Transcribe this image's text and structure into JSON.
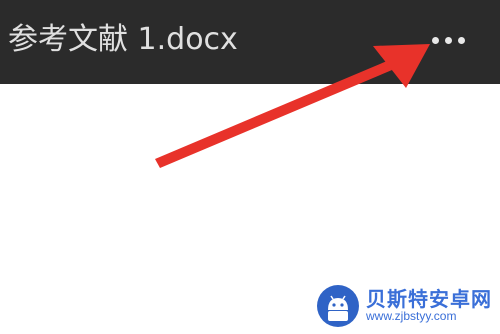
{
  "header": {
    "title": "参考文献 1.docx",
    "more_icon": "more-horizontal-icon"
  },
  "annotation": {
    "arrow_color": "#e8322a"
  },
  "watermark": {
    "name": "贝斯特安卓网",
    "url": "www.zjbstyy.com"
  },
  "colors": {
    "top_bar": "#2b2b2b",
    "content_background": "#ffffff",
    "watermark_blue": "#3a6fd8"
  }
}
